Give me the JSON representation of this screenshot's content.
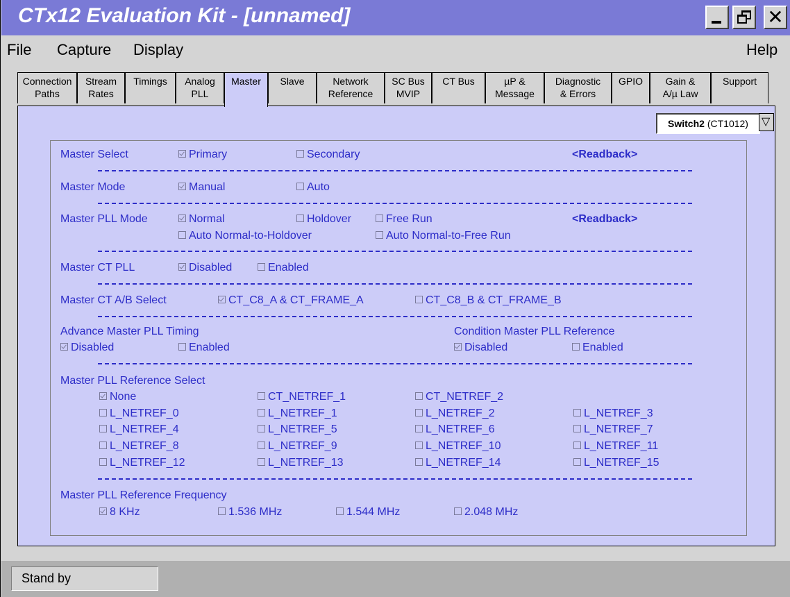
{
  "window": {
    "title": "CTx12 Evaluation Kit - [unnamed]"
  },
  "menu": {
    "file": "File",
    "capture": "Capture",
    "display": "Display",
    "help": "Help"
  },
  "tabs": [
    {
      "line1": "Connection",
      "line2": "Paths"
    },
    {
      "line1": "Stream",
      "line2": "Rates"
    },
    {
      "line1": "Timings",
      "line2": ""
    },
    {
      "line1": "Analog",
      "line2": "PLL"
    },
    {
      "line1": "Master",
      "line2": ""
    },
    {
      "line1": "Slave",
      "line2": ""
    },
    {
      "line1": "Network",
      "line2": "Reference"
    },
    {
      "line1": "SC Bus",
      "line2": "MVIP"
    },
    {
      "line1": "CT Bus",
      "line2": ""
    },
    {
      "line1": "µP &",
      "line2": "Message"
    },
    {
      "line1": "Diagnostic",
      "line2": "& Errors"
    },
    {
      "line1": "GPIO",
      "line2": ""
    },
    {
      "line1": "Gain &",
      "line2": "A/µ Law"
    },
    {
      "line1": "Support",
      "line2": ""
    }
  ],
  "active_tab": "Master",
  "switch_selector": {
    "name": "Switch2",
    "part": "(CT1012)"
  },
  "master_select": {
    "label": "Master Select",
    "primary": "Primary",
    "secondary": "Secondary",
    "readback": "<Readback>"
  },
  "master_mode": {
    "label": "Master Mode",
    "manual": "Manual",
    "auto": "Auto"
  },
  "master_pll_mode": {
    "label": "Master PLL Mode",
    "normal": "Normal",
    "holdover": "Holdover",
    "free_run": "Free Run",
    "readback": "<Readback>",
    "auto_holdover": "Auto Normal-to-Holdover",
    "auto_free_run": "Auto Normal-to-Free Run"
  },
  "master_ct_pll": {
    "label": "Master CT PLL",
    "disabled": "Disabled",
    "enabled": "Enabled"
  },
  "master_ct_ab": {
    "label": "Master CT A/B Select",
    "a": "CT_C8_A & CT_FRAME_A",
    "b": "CT_C8_B & CT_FRAME_B"
  },
  "advance_timing": {
    "label": "Advance Master PLL Timing",
    "disabled": "Disabled",
    "enabled": "Enabled"
  },
  "condition_ref": {
    "label": "Condition Master PLL Reference",
    "disabled": "Disabled",
    "enabled": "Enabled"
  },
  "ref_select": {
    "label": "Master PLL Reference Select",
    "none": "None",
    "ct1": "CT_NETREF_1",
    "ct2": "CT_NETREF_2",
    "l": [
      "L_NETREF_0",
      "L_NETREF_1",
      "L_NETREF_2",
      "L_NETREF_3",
      "L_NETREF_4",
      "L_NETREF_5",
      "L_NETREF_6",
      "L_NETREF_7",
      "L_NETREF_8",
      "L_NETREF_9",
      "L_NETREF_10",
      "L_NETREF_11",
      "L_NETREF_12",
      "L_NETREF_13",
      "L_NETREF_14",
      "L_NETREF_15"
    ]
  },
  "ref_freq": {
    "label": "Master PLL Reference Frequency",
    "f8k": "8 KHz",
    "f1536": "1.536 MHz",
    "f1544": "1.544 MHz",
    "f2048": "2.048 MHz"
  },
  "status": {
    "text": "Stand by"
  }
}
